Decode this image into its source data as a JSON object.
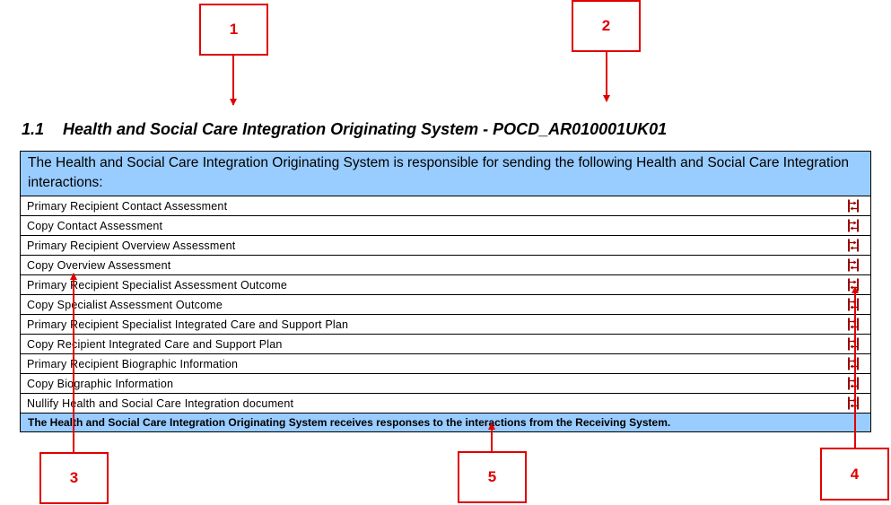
{
  "callouts": [
    "1",
    "2",
    "3",
    "4",
    "5"
  ],
  "heading": {
    "number": "1.1",
    "title": "Health and Social Care Integration Originating System - POCD_AR010001UK01"
  },
  "table": {
    "header": "The Health and Social Care Integration Originating System is responsible for sending the following Health and Social Care Integration interactions:",
    "rows": [
      "Primary Recipient Contact Assessment",
      "Copy Contact Assessment",
      "Primary Recipient Overview Assessment",
      "Copy Overview Assessment",
      "Primary Recipient Specialist Assessment Outcome",
      "Copy Specialist Assessment Outcome",
      "Primary Recipient Specialist Integrated Care and Support Plan",
      "Copy Recipient Integrated Care and Support Plan",
      "Primary Recipient Biographic Information",
      "Copy Biographic Information",
      "Nullify Health and Social Care Integration document"
    ],
    "footer": "The Health and Social Care Integration Originating System receives responses to the interactions from the Receiving System.",
    "row_icon": "interaction-link-icon"
  },
  "colors": {
    "callout": "#e00000",
    "table_header_bg": "#99ccff",
    "icon": "#990000"
  }
}
